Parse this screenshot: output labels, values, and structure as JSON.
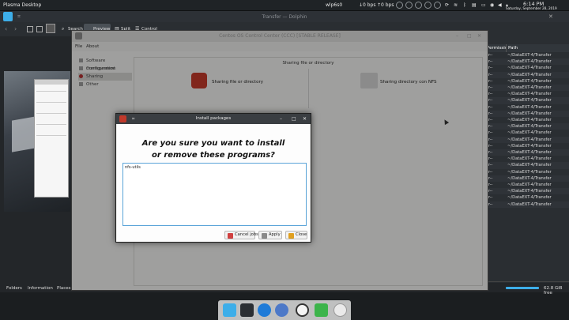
{
  "top_panel": {
    "title": "Plasma Desktop",
    "network_name": "wlp6s0",
    "net_down": "0 bps",
    "net_up": "0 bps",
    "time": "6:14 PM",
    "date": "Saturday, September 28, 2019"
  },
  "dolphin": {
    "window_title": "Transfer — Dolphin",
    "toolbar": {
      "search_label": "Search",
      "preview_label": "Preview",
      "split_label": "Split",
      "control_label": "Control"
    },
    "columns": {
      "permissions": "Permissions",
      "path": "Path"
    },
    "rows": [
      {
        "perm": "-r--",
        "path": "~/DataEXT-4/Transfer"
      },
      {
        "perm": "-r--",
        "path": "~/DataEXT-4/Transfer"
      },
      {
        "perm": "-r--",
        "path": "~/DataEXT-4/Transfer"
      },
      {
        "perm": "-r--",
        "path": "~/DataEXT-4/Transfer"
      },
      {
        "perm": "-r--",
        "path": "~/DataEXT-4/Transfer"
      },
      {
        "perm": "-r--",
        "path": "~/DataEXT-4/Transfer"
      },
      {
        "perm": "-r--",
        "path": "~/DataEXT-4/Transfer"
      },
      {
        "perm": "-r--",
        "path": "~/DataEXT-4/Transfer"
      },
      {
        "perm": "-r--",
        "path": "~/DataEXT-4/Transfer"
      },
      {
        "perm": "-r--",
        "path": "~/DataEXT-4/Transfer"
      },
      {
        "perm": "-r--",
        "path": "~/DataEXT-4/Transfer"
      },
      {
        "perm": "-r--",
        "path": "~/DataEXT-4/Transfer"
      },
      {
        "perm": "-r--",
        "path": "~/DataEXT-4/Transfer"
      },
      {
        "perm": "-r--",
        "path": "~/DataEXT-4/Transfer"
      },
      {
        "perm": "-r--",
        "path": "~/DataEXT-4/Transfer"
      },
      {
        "perm": "-r--",
        "path": "~/DataEXT-4/Transfer"
      },
      {
        "perm": "-r--",
        "path": "~/DataEXT-4/Transfer"
      },
      {
        "perm": "-r--",
        "path": "~/DataEXT-4/Transfer"
      },
      {
        "perm": "-r--",
        "path": "~/DataEXT-4/Transfer"
      },
      {
        "perm": "-r--",
        "path": "~/DataEXT-4/Transfer"
      },
      {
        "perm": "-r--",
        "path": "~/DataEXT-4/Transfer"
      },
      {
        "perm": "-r--",
        "path": "~/DataEXT-4/Transfer"
      },
      {
        "perm": "-r--",
        "path": "~/DataEXT-4/Transfer"
      },
      {
        "perm": "-r--",
        "path": "~/DataEXT-4/Transfer"
      }
    ],
    "bottom_tabs": [
      "Folders",
      "Information",
      "Places"
    ],
    "free_space": "62.8 GiB free"
  },
  "control_center": {
    "window_title": "Centos OS Control Center (CCC) [STABLE RELEASE]",
    "menu": [
      "File",
      "About"
    ],
    "sidebar": [
      "Software management",
      "Configuration",
      "Sharing",
      "Other"
    ],
    "section_title": "Sharing file or directory",
    "options": [
      {
        "label": "Sharing file or directory",
        "icon": "share-icon"
      },
      {
        "label": "Sharing directory con NFS",
        "icon": "nfs-icon"
      }
    ]
  },
  "dialog": {
    "title": "Install packages",
    "question_line1": "Are you sure you want to install",
    "question_line2": "or remove these programs?",
    "packages": [
      "nfs-utils"
    ],
    "buttons": {
      "cancel": "Cancel jobs",
      "apply": "Apply",
      "close": "Close"
    }
  },
  "colors": {
    "accent": "#3daee9",
    "panel_bg": "#1f2326",
    "dialog_border": "#5aa4d8"
  }
}
